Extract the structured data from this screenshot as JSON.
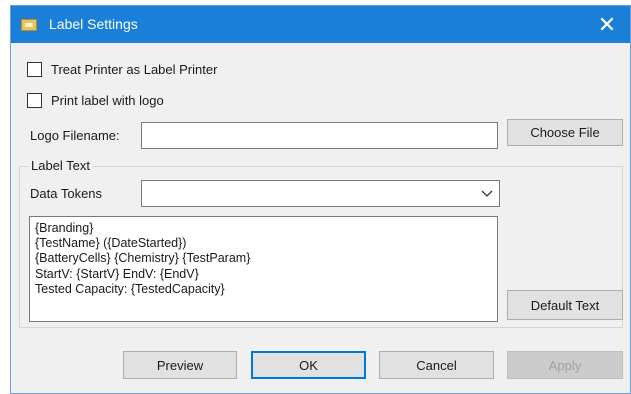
{
  "window": {
    "title": "Label Settings",
    "close_glyph": "✕"
  },
  "options": {
    "treat_printer_label": "Treat Printer as Label Printer",
    "treat_printer_checked": false,
    "print_logo_label": "Print label with logo",
    "print_logo_checked": false
  },
  "logo": {
    "label": "Logo Filename:",
    "value": "",
    "choose_button": "Choose File"
  },
  "label_text": {
    "group_title": "Label Text",
    "tokens_label": "Data Tokens",
    "tokens_selected": "",
    "template_lines": [
      "{Branding}",
      "{TestName} ({DateStarted})",
      "{BatteryCells} {Chemistry} {TestParam}",
      "StartV: {StartV} EndV: {EndV}",
      "Tested Capacity: {TestedCapacity}"
    ],
    "default_text_button": "Default Text"
  },
  "footer": {
    "preview": "Preview",
    "ok": "OK",
    "cancel": "Cancel",
    "apply": "Apply"
  },
  "colors": {
    "titlebar": "#1a7fd9",
    "accent": "#0078d7"
  },
  "icons": {
    "window": "label-settings-icon",
    "close": "close-icon",
    "dropdown": "chevron-down-icon"
  }
}
